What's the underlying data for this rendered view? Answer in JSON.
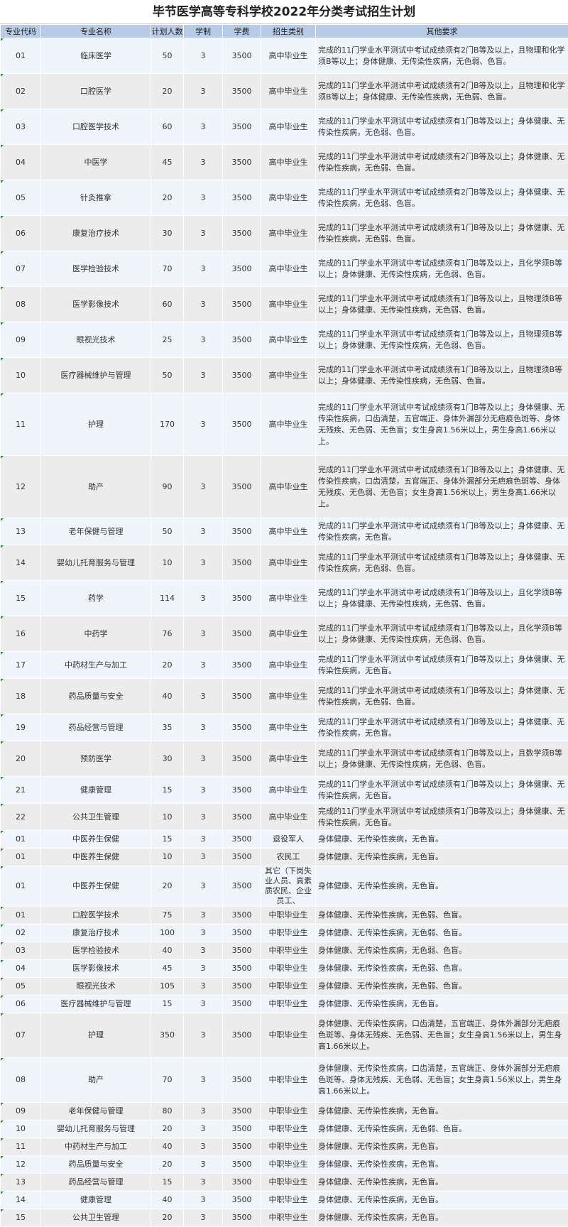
{
  "title": "毕节医学高等专科学校2022年分类考试招生计划",
  "headers": [
    "专业代码",
    "专业名称",
    "计划人数",
    "学制",
    "学费",
    "招生类别",
    "其他要求"
  ],
  "rows": [
    {
      "code": "01",
      "name": "临床医学",
      "plan": "50",
      "years": "3",
      "fee": "3500",
      "category": "高中毕业生",
      "note": "完成的11门学业水平测试中考试成绩须有2门B等及以上，且物理和化学须B等以上；身体健康、无传染性疾病，无色弱、色盲。"
    },
    {
      "code": "02",
      "name": "口腔医学",
      "plan": "20",
      "years": "3",
      "fee": "3500",
      "category": "高中毕业生",
      "note": "完成的11门学业水平测试中考试成绩须有2门B等及以上，且物理和化学须B等以上；身体健康、无传染性疾病，无色弱、色盲。"
    },
    {
      "code": "03",
      "name": "口腔医学技术",
      "plan": "60",
      "years": "3",
      "fee": "3500",
      "category": "高中毕业生",
      "note": "完成的11门学业水平测试中考试成绩须有1门B等及以上；身体健康、无传染性疾病，无色弱、色盲。"
    },
    {
      "code": "04",
      "name": "中医学",
      "plan": "45",
      "years": "3",
      "fee": "3500",
      "category": "高中毕业生",
      "note": "完成的11门学业水平测试中考试成绩须有2门B等及以上；身体健康、无传染性疾病，无色弱、色盲。"
    },
    {
      "code": "05",
      "name": "针灸推拿",
      "plan": "20",
      "years": "3",
      "fee": "3500",
      "category": "高中毕业生",
      "note": "完成的11门学业水平测试中考试成绩须有2门B等及以上；身体健康、无传染性疾病，无色弱、色盲。"
    },
    {
      "code": "06",
      "name": "康复治疗技术",
      "plan": "30",
      "years": "3",
      "fee": "3500",
      "category": "高中毕业生",
      "note": "完成的11门学业水平测试中考试成绩须有1门B等及以上；身体健康、无传染性疾病，无色弱、色盲。"
    },
    {
      "code": "07",
      "name": "医学检验技术",
      "plan": "70",
      "years": "3",
      "fee": "3500",
      "category": "高中毕业生",
      "note": "完成的11门学业水平测试中考试成绩须有1门B等及以上，且化学须B等以上；身体健康、无传染性疾病，无色弱、色盲。"
    },
    {
      "code": "08",
      "name": "医学影像技术",
      "plan": "60",
      "years": "3",
      "fee": "3500",
      "category": "高中毕业生",
      "note": "完成的11门学业水平测试中考试成绩须有1门B等及以上，且物理须B等以上；身体健康、无传染性疾病，无色弱、色盲。"
    },
    {
      "code": "09",
      "name": "眼视光技术",
      "plan": "25",
      "years": "3",
      "fee": "3500",
      "category": "高中毕业生",
      "note": "完成的11门学业水平测试中考试成绩须有1门B等及以上，且物理须B等以上；身体健康、无传染性疾病，无色弱、色盲。"
    },
    {
      "code": "10",
      "name": "医疗器械维护与管理",
      "plan": "50",
      "years": "3",
      "fee": "3500",
      "category": "高中毕业生",
      "note": "完成的11门学业水平测试中考试成绩须有1门B等及以上，且物理须B等以上；身体健康、无传染性疾病，无色弱、色盲。"
    },
    {
      "code": "11",
      "name": "护理",
      "plan": "170",
      "years": "3",
      "fee": "3500",
      "category": "高中毕业生",
      "note": "完成的11门学业水平测试中考试成绩须有1门B等及以上；身体健康、无传染性疾病，口齿清楚，五官端正、身体外漏部分无疤痕色斑等、身体无残疾、无色弱、无色盲；女生身高1.56米以上，男生身高1.66米以上。"
    },
    {
      "code": "12",
      "name": "助产",
      "plan": "90",
      "years": "3",
      "fee": "3500",
      "category": "高中毕业生",
      "note": "完成的11门学业水平测试中考试成绩须有1门B等及以上；身体健康、无传染性疾病，口齿清楚，五官端正、身体外漏部分无疤痕色斑等、身体无残疾、无色弱、无色盲；女生身高1.56米以上，男生身高1.66米以上。"
    },
    {
      "code": "13",
      "name": "老年保健与管理",
      "plan": "50",
      "years": "3",
      "fee": "3500",
      "category": "高中毕业生",
      "note": "完成的11门学业水平测试中考试成绩须有1门B等及以上；身体健康、无传染性疾病，无色盲。"
    },
    {
      "code": "14",
      "name": "婴幼儿托育服务与管理",
      "plan": "10",
      "years": "3",
      "fee": "3500",
      "category": "高中毕业生",
      "note": "完成的11门学业水平测试中考试成绩须有1门B等及以上；身体健康、无传染性疾病，无色弱、色盲。"
    },
    {
      "code": "15",
      "name": "药学",
      "plan": "114",
      "years": "3",
      "fee": "3500",
      "category": "高中毕业生",
      "note": "完成的11门学业水平测试中考试成绩须有1门B等及以上，且化学须B等以上；身体健康、无传染性疾病，无色弱、色盲。"
    },
    {
      "code": "16",
      "name": "中药学",
      "plan": "76",
      "years": "3",
      "fee": "3500",
      "category": "高中毕业生",
      "note": "完成的11门学业水平测试中考试成绩须有1门B等及以上，且化学须B等以上；身体健康、无传染性疾病，无色弱、色盲。"
    },
    {
      "code": "17",
      "name": "中药材生产与加工",
      "plan": "20",
      "years": "3",
      "fee": "3500",
      "category": "高中毕业生",
      "note": "完成的11门学业水平测试中考试成绩须有1门B等及以上；身体健康、无传染性疾病，无色盲。"
    },
    {
      "code": "18",
      "name": "药品质量与安全",
      "plan": "40",
      "years": "3",
      "fee": "3500",
      "category": "高中毕业生",
      "note": "完成的11门学业水平测试中考试成绩须有1门B等及以上；身体健康、无传染性疾病，无色弱、色盲。"
    },
    {
      "code": "19",
      "name": "药品经营与管理",
      "plan": "35",
      "years": "3",
      "fee": "3500",
      "category": "高中毕业生",
      "note": "完成的11门学业水平测试中考试成绩须有1门B等及以上；身体健康、无传染性疾病，无色盲。"
    },
    {
      "code": "20",
      "name": "预防医学",
      "plan": "30",
      "years": "3",
      "fee": "3500",
      "category": "高中毕业生",
      "note": "完成的11门学业水平测试中考试成绩须有1门B等及以上，且数学须B等以上；身体健康、无传染性疾病，无色弱、色盲。"
    },
    {
      "code": "21",
      "name": "健康管理",
      "plan": "15",
      "years": "3",
      "fee": "3500",
      "category": "高中毕业生",
      "note": "完成的11门学业水平测试中考试成绩须有1门B等及以上；身体健康、无传染性疾病，无色盲。"
    },
    {
      "code": "22",
      "name": "公共卫生管理",
      "plan": "10",
      "years": "3",
      "fee": "3500",
      "category": "高中毕业生",
      "note": "完成的11门学业水平测试中考试成绩须有1门B等及以上；身体健康、无传染性疾病，无色盲。"
    },
    {
      "code": "01",
      "name": "中医养生保健",
      "plan": "15",
      "years": "3",
      "fee": "3500",
      "category": "退役军人",
      "note": "身体健康、无传染性疾病，无色盲。"
    },
    {
      "code": "01",
      "name": "中医养生保健",
      "plan": "10",
      "years": "3",
      "fee": "3500",
      "category": "农民工",
      "note": "身体健康、无传染性疾病，无色盲。"
    },
    {
      "code": "01",
      "name": "中医养生保健",
      "plan": "20",
      "years": "3",
      "fee": "3500",
      "category": "其它（下岗失业人员、高素质农民、企业员工、",
      "note": "身体健康、无传染性疾病，无色盲。"
    },
    {
      "code": "01",
      "name": "口腔医学技术",
      "plan": "75",
      "years": "3",
      "fee": "3500",
      "category": "中职毕业生",
      "note": "身体健康、无传染性疾病，无色弱、色盲。"
    },
    {
      "code": "02",
      "name": "康复治疗技术",
      "plan": "100",
      "years": "3",
      "fee": "3500",
      "category": "中职毕业生",
      "note": "身体健康、无传染性疾病，无色弱、色盲。"
    },
    {
      "code": "03",
      "name": "医学检验技术",
      "plan": "40",
      "years": "3",
      "fee": "3500",
      "category": "中职毕业生",
      "note": "身体健康、无传染性疾病，无色弱、色盲。"
    },
    {
      "code": "04",
      "name": "医学影像技术",
      "plan": "45",
      "years": "3",
      "fee": "3500",
      "category": "中职毕业生",
      "note": "身体健康、无传染性疾病，无色弱、色盲。"
    },
    {
      "code": "05",
      "name": "眼视光技术",
      "plan": "105",
      "years": "3",
      "fee": "3500",
      "category": "中职毕业生",
      "note": "身体健康、无传染性疾病，无色弱、色盲。"
    },
    {
      "code": "06",
      "name": "医疗器械维护与管理",
      "plan": "15",
      "years": "3",
      "fee": "3500",
      "category": "中职毕业生",
      "note": "身体健康、无传染性疾病，无色盲。"
    },
    {
      "code": "07",
      "name": "护理",
      "plan": "350",
      "years": "3",
      "fee": "3500",
      "category": "中职毕业生",
      "note": "身体健康、无传染性疾病，口齿清楚，五官端正、身体外漏部分无疤痕色斑等、身体无残疾、无色弱、无色盲；女生身高1.56米以上，男生身高1.66米以上。"
    },
    {
      "code": "08",
      "name": "助产",
      "plan": "70",
      "years": "3",
      "fee": "3500",
      "category": "中职毕业生",
      "note": "身体健康、无传染性疾病，口齿清楚，五官端正、身体外漏部分无疤痕色斑等、身体无残疾、无色弱、无色盲；女生身高1.56米以上，男生身高1.66米以上。"
    },
    {
      "code": "09",
      "name": "老年保健与管理",
      "plan": "80",
      "years": "3",
      "fee": "3500",
      "category": "中职毕业生",
      "note": "身体健康、无传染性疾病，无色盲。"
    },
    {
      "code": "10",
      "name": "婴幼儿托育服务与管理",
      "plan": "20",
      "years": "3",
      "fee": "3500",
      "category": "中职毕业生",
      "note": "身体健康、无传染性疾病，无色弱、色盲。"
    },
    {
      "code": "11",
      "name": "中药材生产与加工",
      "plan": "40",
      "years": "3",
      "fee": "3500",
      "category": "中职毕业生",
      "note": "身体健康、无传染性疾病，无色盲。"
    },
    {
      "code": "12",
      "name": "药品质量与安全",
      "plan": "20",
      "years": "3",
      "fee": "3500",
      "category": "中职毕业生",
      "note": "身体健康、无传染性疾病，无色盲。"
    },
    {
      "code": "13",
      "name": "药品经营与管理",
      "plan": "15",
      "years": "3",
      "fee": "3500",
      "category": "中职毕业生",
      "note": "身体健康、无传染性疾病，无色盲。"
    },
    {
      "code": "14",
      "name": "健康管理",
      "plan": "40",
      "years": "3",
      "fee": "3500",
      "category": "中职毕业生",
      "note": "身体健康、无传染性疾病，无色盲。"
    },
    {
      "code": "15",
      "name": "公共卫生管理",
      "plan": "20",
      "years": "3",
      "fee": "3500",
      "category": "中职毕业生",
      "note": "身体健康、无传染性疾病，无色盲。"
    }
  ]
}
